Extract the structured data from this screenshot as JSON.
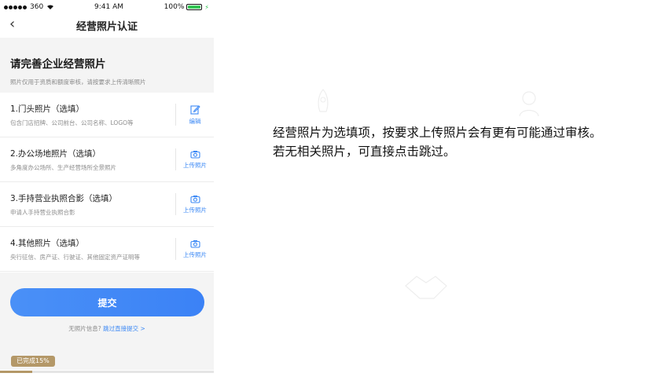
{
  "status_bar": {
    "carrier": "360",
    "time": "9:41 AM",
    "battery": "100%"
  },
  "nav": {
    "title": "经营照片认证"
  },
  "intro": {
    "title": "请完善企业经营照片",
    "subtitle": "照片仅用于资质和额度审核，请按要求上传清晰照片"
  },
  "items": [
    {
      "title": "1.门头照片（选填）",
      "desc": "包含门店招牌、公司前台、公司名称、LOGO等",
      "action": "编辑",
      "icon": "edit-icon"
    },
    {
      "title": "2.办公场地照片（选填）",
      "desc": "多角度办公场所、生产经营场所全景照片",
      "action": "上传照片",
      "icon": "camera-icon"
    },
    {
      "title": "3.手持营业执照合影（选填）",
      "desc": "申请人手持营业执照合影",
      "action": "上传照片",
      "icon": "camera-icon"
    },
    {
      "title": "4.其他照片（选填）",
      "desc": "央行征信、房产证、行驶证、其他固定资产证明等",
      "action": "上传照片",
      "icon": "camera-icon"
    }
  ],
  "submit_label": "提交",
  "skip": {
    "prefix": "无照片信息?",
    "link": "跳过直接提交 >"
  },
  "progress": {
    "label": "已完成15%",
    "value": 0.15
  },
  "caption": {
    "line1": "经营照片为选填项，按要求上传照片会有更有可能通过审核。",
    "line2": "若无相关照片，可直接点击跳过。"
  },
  "colors": {
    "accent": "#3b88f5",
    "progress": "#b49868",
    "battery": "#33c553"
  }
}
